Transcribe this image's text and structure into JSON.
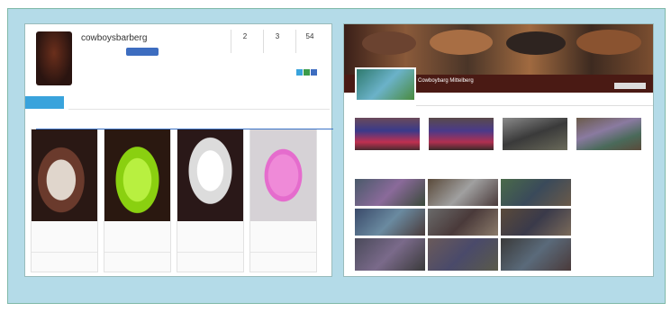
{
  "left_profile": {
    "username": "cowboysbarberg",
    "stats": [
      {
        "number": "2",
        "label": ""
      },
      {
        "number": "3",
        "label": ""
      },
      {
        "number": "54",
        "label": ""
      }
    ],
    "products": [
      {
        "color": "#3a2420",
        "accent": "#c8c0b8"
      },
      {
        "color": "#2a3a10",
        "accent": "#a8e030"
      },
      {
        "color": "#2a1818",
        "accent": "#e4e4e4"
      },
      {
        "color": "#d0c8d0",
        "accent": "#e07fc8"
      }
    ]
  },
  "right_page": {
    "page_name": "Cowboybarg Mittelberg"
  },
  "colors": {
    "frame": "#b4dbe8",
    "follow_button": "#39a3dc",
    "edit_button": "#3d6dc0",
    "cover_band": "#4a1a14",
    "guide_line": "#3b74c8"
  }
}
